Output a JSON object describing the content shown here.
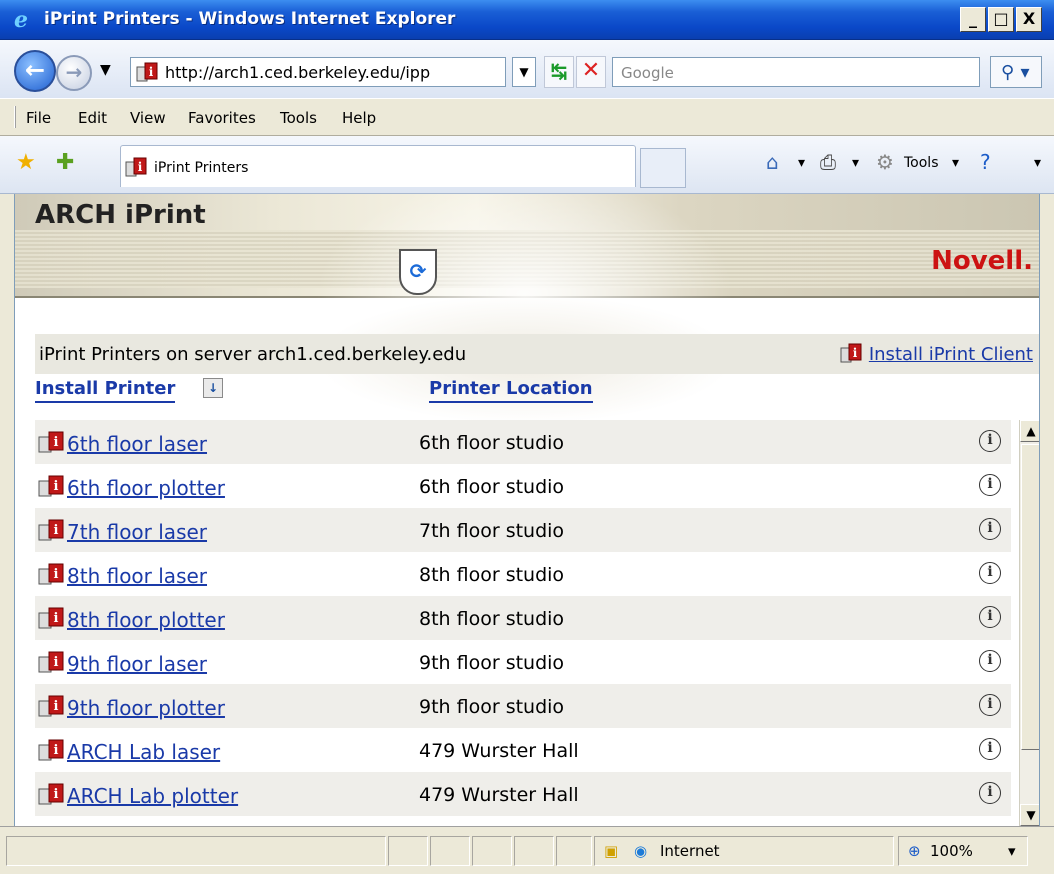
{
  "window": {
    "title": "iPrint Printers - Windows Internet Explorer",
    "controls": {
      "minimize": "_",
      "maximize": "□",
      "close": "X"
    }
  },
  "addressbar": {
    "url": "http://arch1.ced.berkeley.edu/ipp",
    "search_placeholder": "Google",
    "back_glyph": "←",
    "forward_glyph": "→",
    "go_glyph": "↹",
    "stop_glyph": "✕",
    "search_glyph": "⚲ ▾"
  },
  "menubar": {
    "items": [
      "File",
      "Edit",
      "View",
      "Favorites",
      "Tools",
      "Help"
    ]
  },
  "favbar": {
    "tab_label": "iPrint Printers",
    "tools_label": "Tools"
  },
  "page": {
    "brand": "ARCH iPrint",
    "vendor": "Novell.",
    "server_text": "iPrint Printers on server arch1.ced.berkeley.edu",
    "install_client": "Install iPrint Client",
    "col_install": "Install Printer",
    "col_location": "Printer Location",
    "printers": [
      {
        "name": "6th floor laser",
        "location": "6th floor studio"
      },
      {
        "name": "6th floor plotter",
        "location": "6th floor studio"
      },
      {
        "name": "7th floor laser",
        "location": "7th floor studio"
      },
      {
        "name": "8th floor laser",
        "location": "8th floor studio"
      },
      {
        "name": "8th floor plotter",
        "location": "8th floor studio"
      },
      {
        "name": "9th floor laser",
        "location": "9th floor studio"
      },
      {
        "name": "9th floor plotter",
        "location": "9th floor studio"
      },
      {
        "name": "ARCH Lab laser",
        "location": "479 Wurster Hall"
      },
      {
        "name": "ARCH Lab plotter",
        "location": "479 Wurster Hall"
      }
    ]
  },
  "statusbar": {
    "zone": "Internet",
    "zoom": "100%"
  }
}
